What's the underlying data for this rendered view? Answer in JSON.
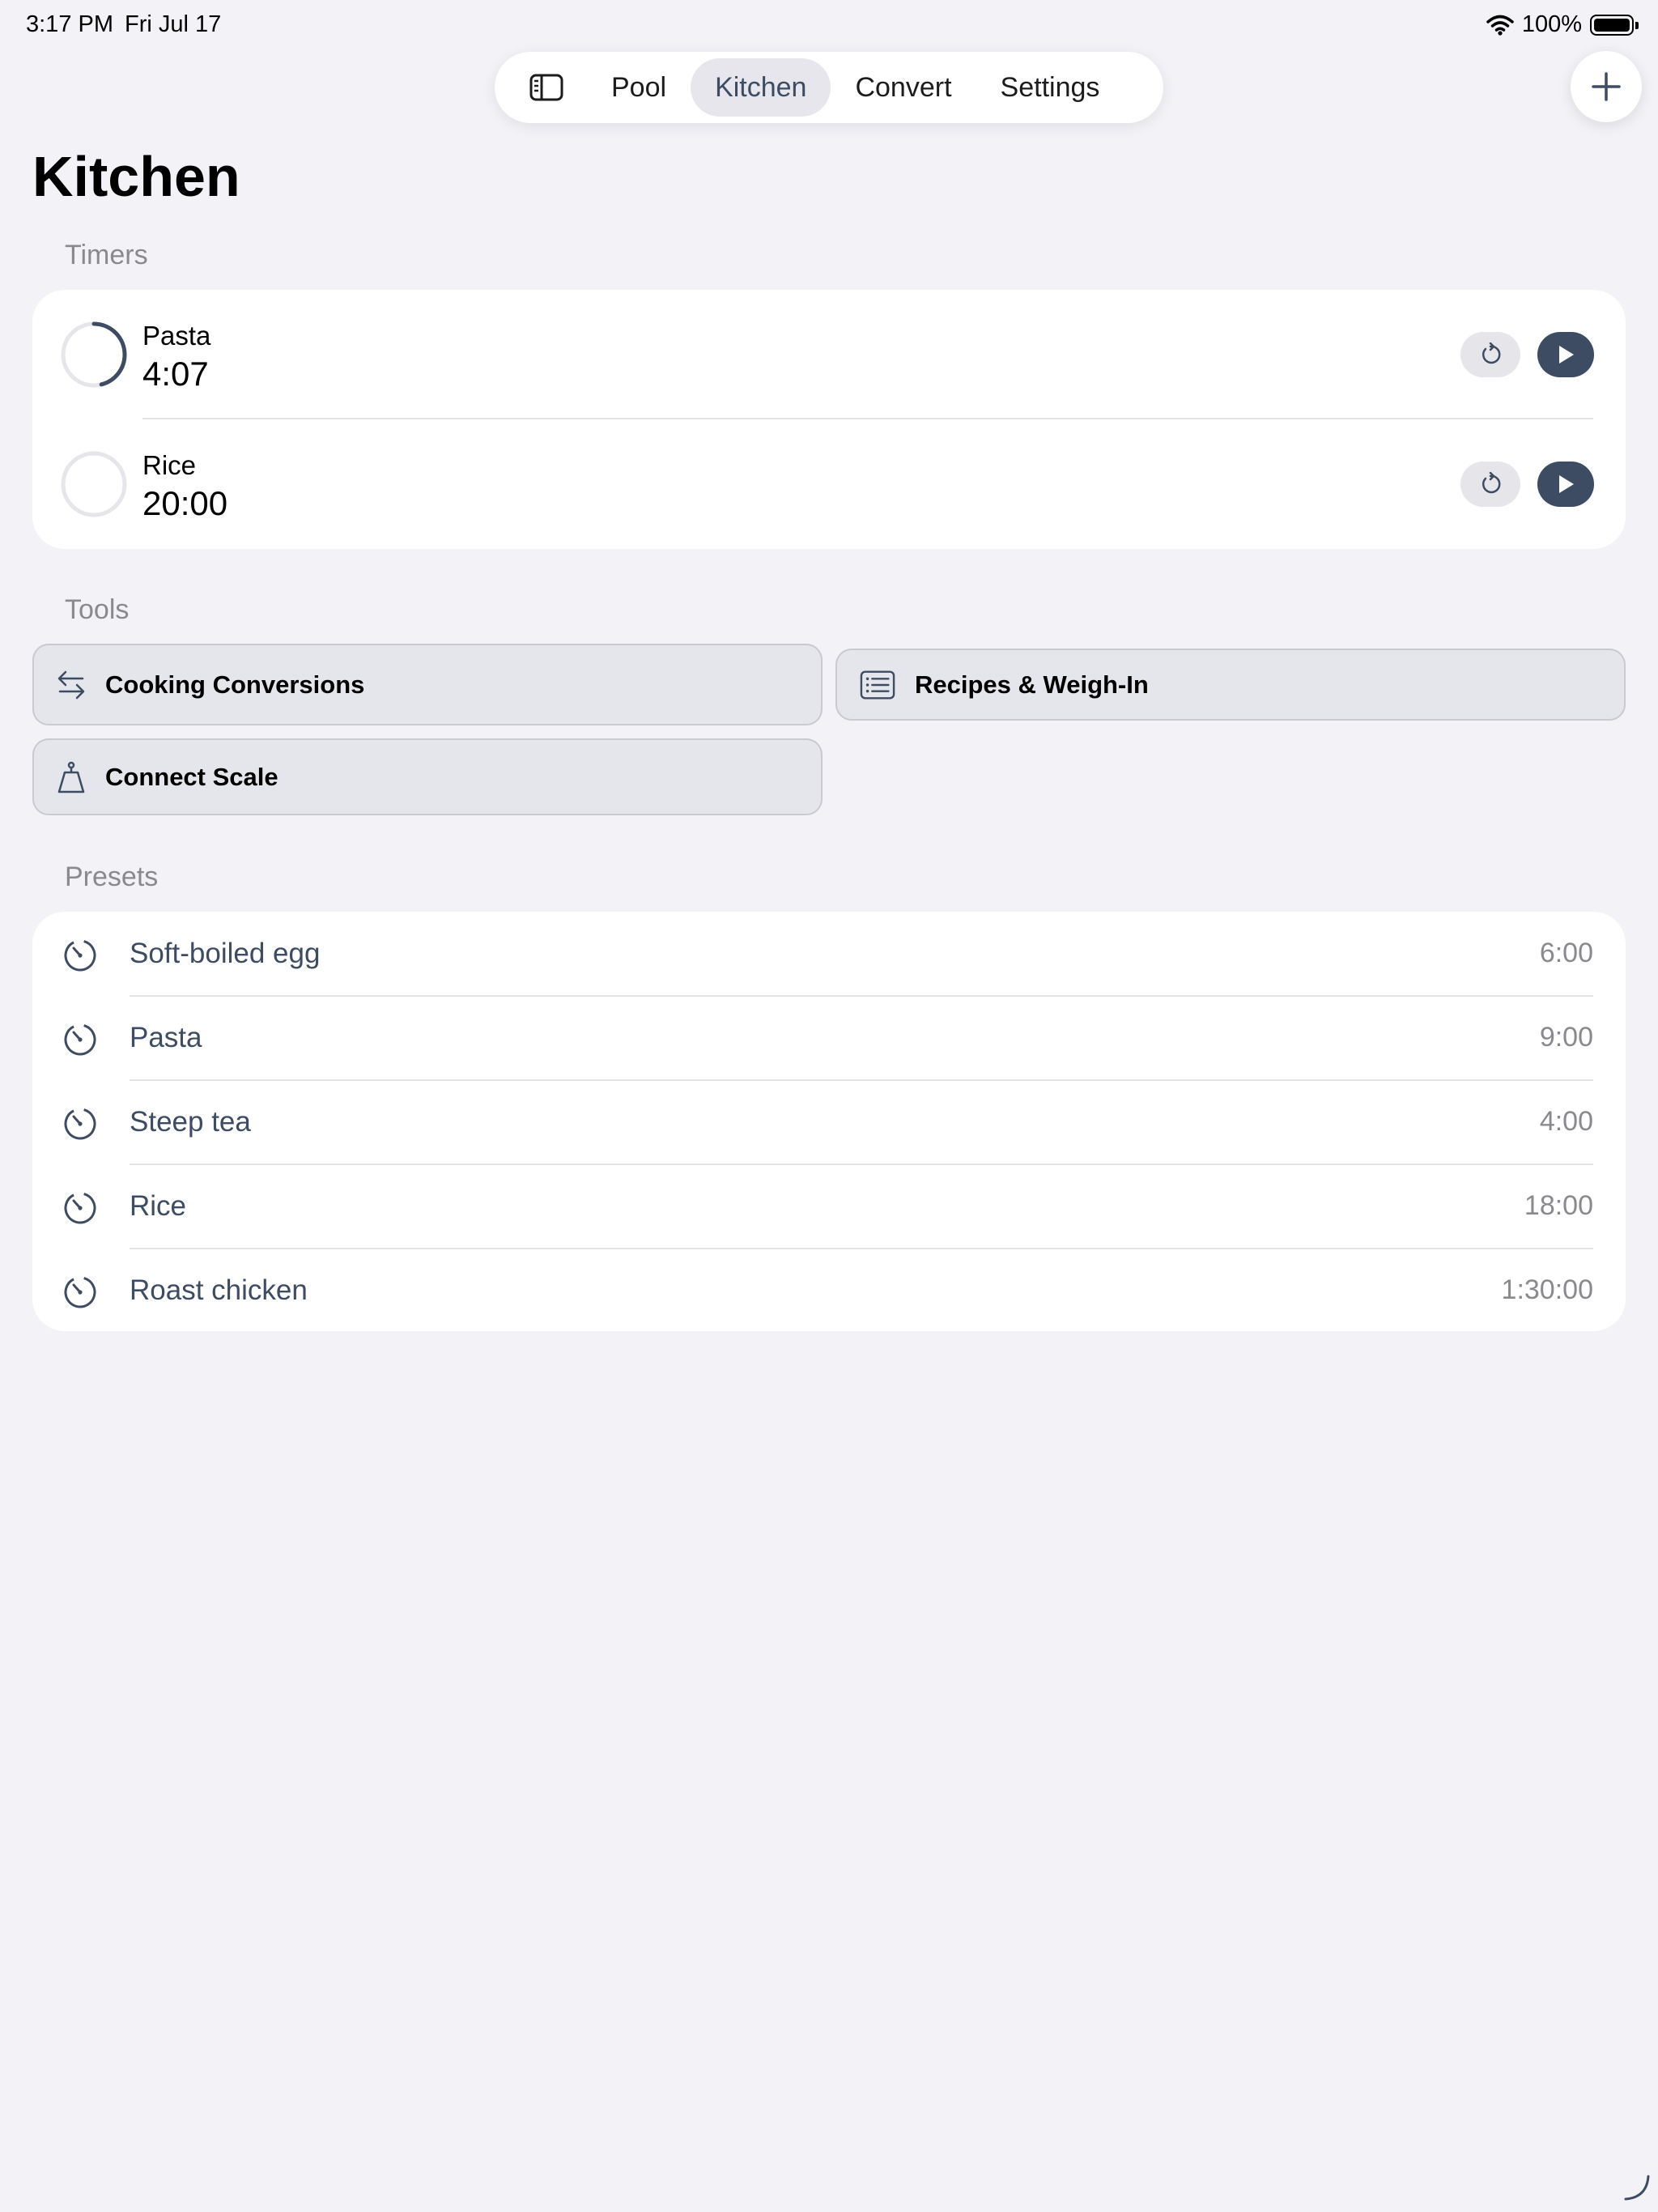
{
  "status_bar": {
    "time": "3:17 PM",
    "date": "Fri Jul 17",
    "battery": "100%"
  },
  "nav": {
    "tabs": [
      {
        "label": "Pool",
        "active": false
      },
      {
        "label": "Kitchen",
        "active": true
      },
      {
        "label": "Convert",
        "active": false
      },
      {
        "label": "Settings",
        "active": false
      }
    ]
  },
  "page": {
    "title": "Kitchen"
  },
  "timers": {
    "header": "Timers",
    "items": [
      {
        "name": "Pasta",
        "time": "4:07",
        "progress": 0.46
      },
      {
        "name": "Rice",
        "time": "20:00",
        "progress": 0
      }
    ]
  },
  "tools": {
    "header": "Tools",
    "items": [
      {
        "label": "Cooking Conversions",
        "icon": "arrows-left-right-icon"
      },
      {
        "label": "Recipes & Weigh-In",
        "icon": "list-icon"
      },
      {
        "label": "Connect Scale",
        "icon": "scale-icon"
      }
    ]
  },
  "presets": {
    "header": "Presets",
    "items": [
      {
        "name": "Soft-boiled egg",
        "time": "6:00"
      },
      {
        "name": "Pasta",
        "time": "9:00"
      },
      {
        "name": "Steep tea",
        "time": "4:00"
      },
      {
        "name": "Rice",
        "time": "18:00"
      },
      {
        "name": "Roast chicken",
        "time": "1:30:00"
      }
    ]
  },
  "colors": {
    "background": "#F2F2F7",
    "accent": "#3D4C63",
    "card": "#FFFFFF",
    "secondary_text": "#8A8A8E",
    "track": "#E5E5EA"
  }
}
